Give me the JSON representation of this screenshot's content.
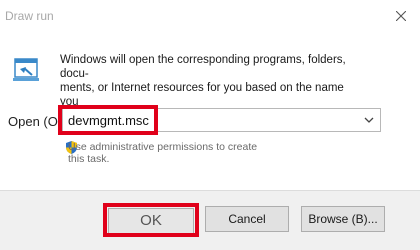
{
  "window": {
    "title": "Draw run"
  },
  "description": "Windows will open the corresponding programs, folders, docu-\nments, or Internet resources for you based on the name you\nentered.",
  "open": {
    "label": "Open (O):",
    "value": "devmgmt.msc"
  },
  "admin_note": "Use administrative permissions to create\nthis task.",
  "buttons": {
    "ok": "OK",
    "cancel": "Cancel",
    "browse": "Browse (B)..."
  },
  "colors": {
    "highlight": "#e0001a",
    "footer": "#f0f0f0"
  },
  "icons": [
    "run-icon",
    "close-icon",
    "shield-icon",
    "chevron-down-icon"
  ]
}
